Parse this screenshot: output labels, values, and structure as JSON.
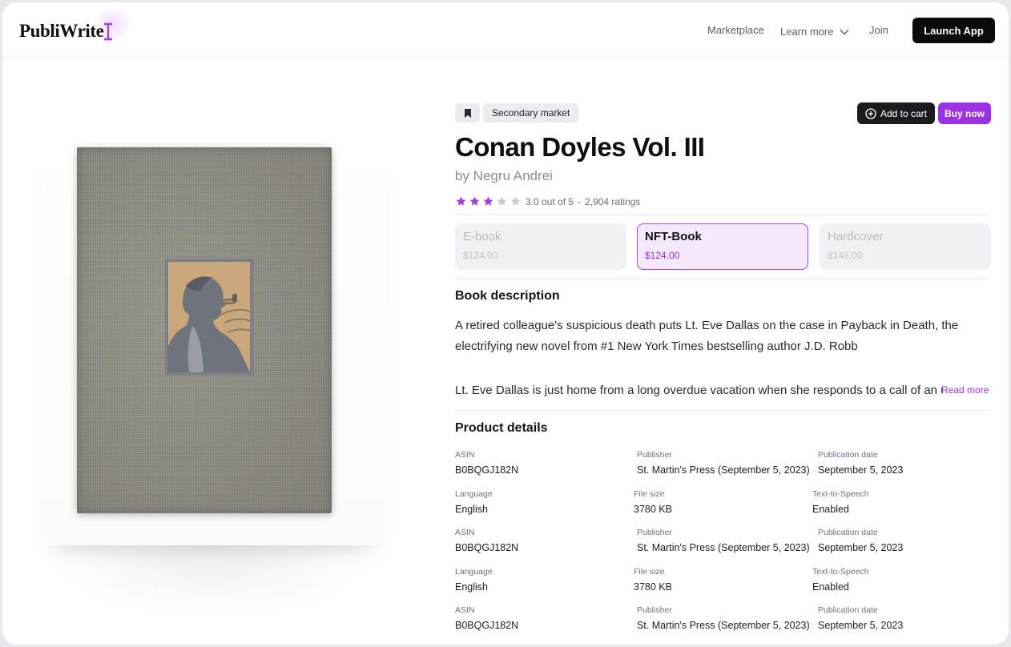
{
  "header": {
    "logo": "PubliWrite",
    "nav": {
      "marketplace": "Marketplace",
      "learn_more": "Learn more",
      "join": "Join"
    },
    "launch_app": "Launch App"
  },
  "product": {
    "tag": "Secondary market",
    "add_to_cart": "Add to cart",
    "buy_now": "Buy now",
    "title": "Conan Doyles Vol. III",
    "author": "by Negru Andrei",
    "rating": {
      "stars": 3,
      "max": 5,
      "text": "3.0 out of 5",
      "separator": "-",
      "count": "2,904 ratings"
    },
    "formats": [
      {
        "name": "E-book",
        "price": "$124.00",
        "selected": false
      },
      {
        "name": "NFT-Book",
        "price": "$124.00",
        "selected": true
      },
      {
        "name": "Hardcover",
        "price": "$148.00",
        "selected": false
      }
    ],
    "description": {
      "title": "Book description",
      "para1": "A retired colleague's suspicious death puts Lt. Eve Dallas on the case in Payback in Death, the electrifying new novel from #1 New York Times bestselling author J.D. Robb",
      "para2": "Lt. Eve Dallas is just home from a long overdue vacation when she responds to a call of an u",
      "read_more": "Read more"
    },
    "details": {
      "title": "Product details",
      "rows": [
        [
          {
            "label": "ASIN",
            "value": "B0BQGJ182N"
          },
          {
            "label": "Publisher",
            "value": "St. Martin's Press (September 5, 2023)"
          },
          {
            "label": "Publication date",
            "value": "September 5, 2023"
          }
        ],
        [
          {
            "label": "Language",
            "value": "English"
          },
          {
            "label": "File size",
            "value": "3780 KB"
          },
          {
            "label": "Text-to-Speech",
            "value": "Enabled"
          }
        ],
        [
          {
            "label": "ASIN",
            "value": "B0BQGJ182N"
          },
          {
            "label": "Publisher",
            "value": "St. Martin's Press (September 5, 2023)"
          },
          {
            "label": "Publication date",
            "value": "September 5, 2023"
          }
        ],
        [
          {
            "label": "Language",
            "value": "English"
          },
          {
            "label": "File size",
            "value": "3780 KB"
          },
          {
            "label": "Text-to-Speech",
            "value": "Enabled"
          }
        ],
        [
          {
            "label": "ASIN",
            "value": "B0BQGJ182N"
          },
          {
            "label": "Publisher",
            "value": "St. Martin's Press (September 5, 2023)"
          },
          {
            "label": "Publication date",
            "value": "September 5, 2023"
          }
        ]
      ]
    }
  },
  "icons": {
    "bookmark": "bookmark-icon",
    "add_circle": "plus-circle-icon",
    "chevron": "chevron-down-icon",
    "star": "star-icon"
  },
  "colors": {
    "accent": "#9b33e4",
    "star_filled": "#a43be6",
    "star_empty": "#c8cad0",
    "selected_bg": "#f6e9fb"
  }
}
